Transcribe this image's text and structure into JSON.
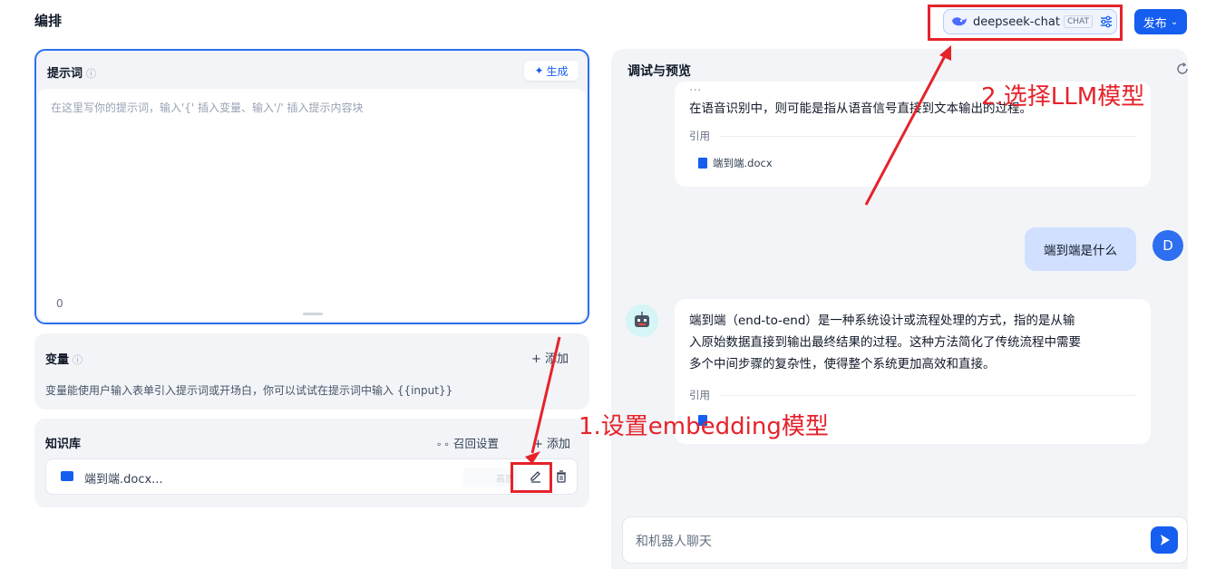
{
  "header": {
    "title": "编排",
    "publish_label": "发布"
  },
  "model": {
    "name": "deepseek-chat",
    "badge": "CHAT"
  },
  "prompt": {
    "title": "提示词",
    "generate_label": "生成",
    "placeholder": "在这里写你的提示词，输入'{' 插入变量、输入'/' 插入提示内容块",
    "char_count": "0"
  },
  "variables": {
    "title": "变量",
    "add_label": "添加",
    "description": "变量能使用户输入表单引入提示词或开场白，你可以试试在提示词中输入 {{input}}"
  },
  "knowledge": {
    "title": "知识库",
    "recall_label": "召回设置",
    "add_label": "添加",
    "item_name": "端到端.docx...",
    "item_tag": "高质"
  },
  "debug": {
    "title": "调试与预览",
    "prev_answer_partial": "在语音识别中，则可能是指从语音信号直接到文本输出的过程。",
    "cite_label": "引用",
    "doc_name": "端到端.docx",
    "user_message": "端到端是什么",
    "user_avatar": "D",
    "bot_answer_1": "端到端（end-to-end）是一种系统设计或流程处理的方式，指的是从输",
    "bot_answer_2": "入原始数据直接到输出最终结果的过程。这种方法简化了传统流程中需要",
    "bot_answer_3": "多个中间步骤的复杂性，使得整个系统更加高效和直接。",
    "cite_label_2": "引用",
    "chat_placeholder": "和机器人聊天"
  },
  "annotations": {
    "step1": "1.设置embedding模型",
    "step2": "2.选择LLM模型"
  },
  "colors": {
    "accent": "#155eef",
    "annotation_red": "#e5232b",
    "panel_bg": "#f2f4f7"
  }
}
